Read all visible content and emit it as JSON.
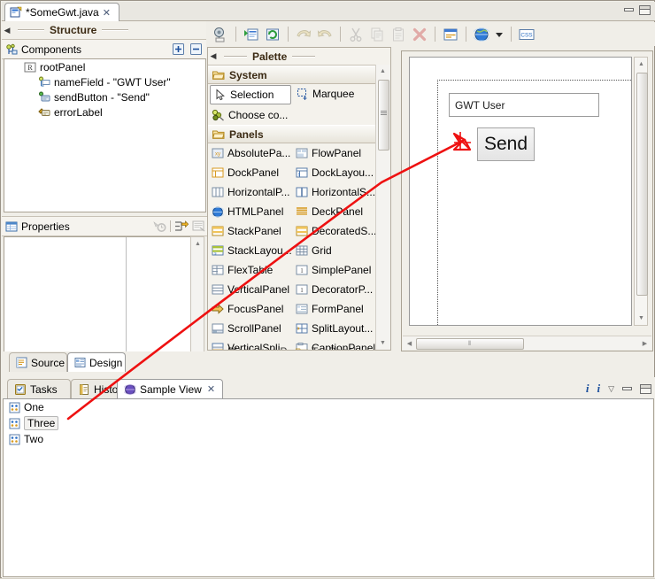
{
  "window": {
    "min_label": "Minimize",
    "max_label": "Maximize"
  },
  "editor_tab": {
    "title": "*SomeGwt.java",
    "close_label": "✕",
    "icon": "java-file-icon"
  },
  "structure_view": {
    "title": "Structure",
    "collapse_arrow": "◀",
    "components": {
      "title": "Components",
      "icon": "components-icon",
      "expand_all_label": "+",
      "collapse_all_label": "−"
    },
    "tree": [
      {
        "label": "rootPanel",
        "icon": "root-panel-icon",
        "indent": 0
      },
      {
        "label": "nameField - \"GWT User\"",
        "icon": "textbox-icon",
        "indent": 1
      },
      {
        "label": "sendButton - \"Send\"",
        "icon": "button-icon",
        "indent": 1
      },
      {
        "label": "errorLabel",
        "icon": "label-icon",
        "indent": 1
      }
    ]
  },
  "properties_view": {
    "title": "Properties",
    "icon": "properties-icon",
    "tools": [
      {
        "name": "restore-default-icon",
        "title": "Restore default value"
      },
      {
        "name": "show-advanced-icon",
        "title": "Show advanced properties"
      },
      {
        "name": "show-events-icon",
        "title": "Show events"
      }
    ],
    "rows": []
  },
  "source_design_tabs": [
    {
      "label": "Source",
      "icon": "source-icon",
      "active": false
    },
    {
      "label": "Design",
      "icon": "design-icon",
      "active": true
    }
  ],
  "toolbar": {
    "buttons": [
      {
        "name": "test-preview-icon",
        "label": "Test/Preview",
        "enabled": true
      },
      {
        "name": "open-in-editor-icon",
        "label": "Open in editor",
        "enabled": true
      },
      {
        "name": "refresh-icon",
        "label": "Refresh",
        "enabled": true
      },
      {
        "name": "undo-icon",
        "label": "Undo",
        "enabled": false
      },
      {
        "name": "redo-icon",
        "label": "Redo",
        "enabled": false
      },
      {
        "name": "cut-icon",
        "label": "Cut",
        "enabled": false
      },
      {
        "name": "copy-icon",
        "label": "Copy",
        "enabled": false
      },
      {
        "name": "paste-icon",
        "label": "Paste",
        "enabled": false
      },
      {
        "name": "delete-icon",
        "label": "Delete",
        "enabled": false
      },
      {
        "name": "align-icon",
        "label": "Alignment",
        "enabled": true
      },
      {
        "name": "globe-icon",
        "label": "Locale",
        "enabled": true
      },
      {
        "name": "dropdown-arrow-icon",
        "label": "▾",
        "enabled": true
      },
      {
        "name": "css-icon",
        "label": "CSS",
        "enabled": true
      }
    ]
  },
  "palette": {
    "title": "Palette",
    "collapse_arrow": "◀",
    "categories": [
      {
        "name": "System",
        "icon": "folder-icon",
        "items": [
          {
            "label": "Selection",
            "icon": "cursor-icon",
            "selected": true
          },
          {
            "label": "Marquee",
            "icon": "marquee-icon",
            "selected": false
          },
          {
            "label": "Choose co...",
            "icon": "choose-component-icon",
            "selected": false
          }
        ]
      },
      {
        "name": "Panels",
        "icon": "folder-icon",
        "items": [
          {
            "label": "AbsolutePa...",
            "icon": "absolute-panel-icon"
          },
          {
            "label": "FlowPanel",
            "icon": "flow-panel-icon"
          },
          {
            "label": "DockPanel",
            "icon": "dock-panel-icon"
          },
          {
            "label": "DockLayou...",
            "icon": "dock-layout-panel-icon"
          },
          {
            "label": "HorizontalP...",
            "icon": "horizontal-panel-icon"
          },
          {
            "label": "HorizontalS...",
            "icon": "horizontal-split-icon"
          },
          {
            "label": "HTMLPanel",
            "icon": "html-panel-icon"
          },
          {
            "label": "DeckPanel",
            "icon": "deck-panel-icon"
          },
          {
            "label": "StackPanel",
            "icon": "stack-panel-icon"
          },
          {
            "label": "DecoratedS...",
            "icon": "decorated-stack-icon"
          },
          {
            "label": "StackLayou...",
            "icon": "stack-layout-icon"
          },
          {
            "label": "Grid",
            "icon": "grid-icon"
          },
          {
            "label": "FlexTable",
            "icon": "flex-table-icon"
          },
          {
            "label": "SimplePanel",
            "icon": "simple-panel-icon"
          },
          {
            "label": "VerticalPanel",
            "icon": "vertical-panel-icon"
          },
          {
            "label": "DecoratorP...",
            "icon": "decorator-panel-icon"
          },
          {
            "label": "FocusPanel",
            "icon": "focus-panel-icon"
          },
          {
            "label": "FormPanel",
            "icon": "form-panel-icon"
          },
          {
            "label": "ScrollPanel",
            "icon": "scroll-panel-icon"
          },
          {
            "label": "SplitLayout...",
            "icon": "split-layout-icon"
          },
          {
            "label": "VerticalSpli...",
            "icon": "vertical-split-icon"
          },
          {
            "label": "CaptionPanel",
            "icon": "caption-panel-icon"
          }
        ]
      }
    ]
  },
  "canvas": {
    "name_field_value": "GWT User",
    "send_button_label": "Send",
    "scroll_grip": "⦀"
  },
  "bottom_view": {
    "tabs": [
      {
        "label": "Tasks",
        "icon": "tasks-icon",
        "active": false,
        "closable": false
      },
      {
        "label": "History",
        "icon": "history-icon",
        "active": false,
        "closable": false
      },
      {
        "label": "Sample View",
        "icon": "sample-view-icon",
        "active": true,
        "closable": true,
        "close_label": "✕"
      }
    ],
    "tools": [
      {
        "name": "info-icon-1",
        "label": "i"
      },
      {
        "name": "info-icon-2",
        "label": "i"
      },
      {
        "name": "view-menu-icon",
        "label": "▽"
      },
      {
        "name": "minimize-icon",
        "label": "minimize"
      },
      {
        "name": "maximize-icon",
        "label": "maximize"
      }
    ],
    "list": [
      {
        "label": "One",
        "icon": "item-icon",
        "selected": false
      },
      {
        "label": "Three",
        "icon": "item-icon",
        "selected": true
      },
      {
        "label": "Two",
        "icon": "item-icon",
        "selected": false
      }
    ]
  },
  "annotation": {
    "color": "#ee1111",
    "description": "red arrow pointing to Send button"
  }
}
